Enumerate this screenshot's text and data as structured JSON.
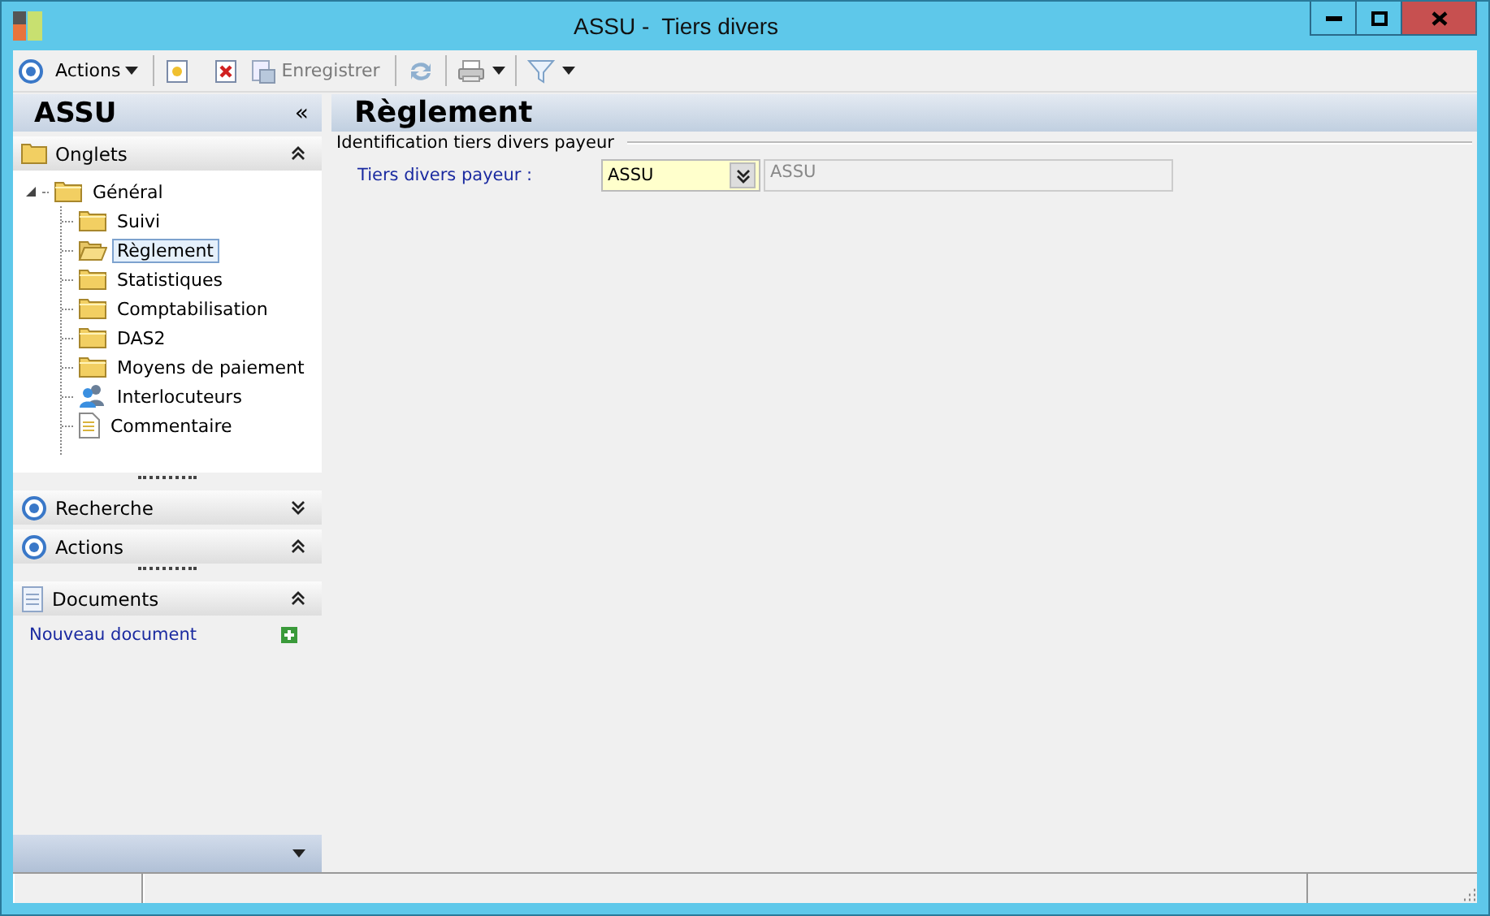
{
  "window": {
    "title": "ASSU -  Tiers divers"
  },
  "toolbar": {
    "actions_label": "Actions",
    "save_label": "Enregistrer",
    "save_disabled": true
  },
  "sidebar": {
    "title": "ASSU",
    "collapse_glyph": "«",
    "sections": [
      {
        "label": "Onglets",
        "kind": "tree",
        "expanded": true
      },
      {
        "label": "Recherche",
        "kind": "action",
        "expanded": false
      },
      {
        "label": "Actions",
        "kind": "action",
        "expanded": true
      },
      {
        "label": "Documents",
        "kind": "documents",
        "expanded": true
      }
    ],
    "tree": [
      {
        "label": "Général",
        "kind": "folder",
        "expanded": true,
        "selected": false,
        "children": [
          {
            "label": "Suivi",
            "kind": "folder",
            "selected": false
          },
          {
            "label": "Règlement",
            "kind": "folder",
            "selected": true
          },
          {
            "label": "Statistiques",
            "kind": "folder",
            "selected": false
          },
          {
            "label": "Comptabilisation",
            "kind": "folder",
            "selected": false
          },
          {
            "label": "DAS2",
            "kind": "folder",
            "selected": false
          },
          {
            "label": "Moyens de paiement",
            "kind": "folder",
            "selected": false
          },
          {
            "label": "Interlocuteurs",
            "kind": "contacts",
            "selected": false
          },
          {
            "label": "Commentaire",
            "kind": "note",
            "selected": false
          }
        ]
      }
    ],
    "documents_link": "Nouveau document"
  },
  "content": {
    "title": "Règlement",
    "group": "Identification tiers divers payeur",
    "fields": [
      {
        "label": "Tiers divers payeur :",
        "value": "ASSU",
        "description": "ASSU"
      }
    ]
  }
}
